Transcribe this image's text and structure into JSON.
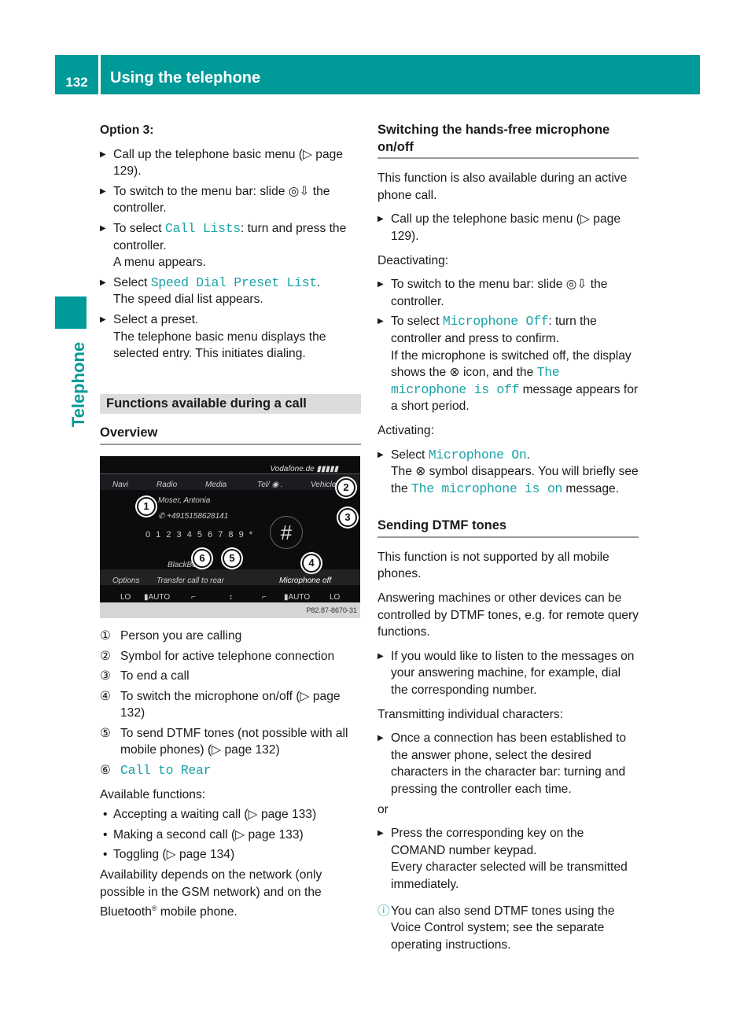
{
  "header": {
    "page_number": "132",
    "title": "Using the telephone"
  },
  "side_tab": "Telephone",
  "left": {
    "option_heading": "Option 3:",
    "steps": [
      {
        "a": "Call up the telephone basic menu (▷ page 129)."
      },
      {
        "a": "To switch to the menu bar: slide ◎⇩ the controller."
      },
      {
        "a": "To select ",
        "link": "Call Lists",
        "b": ": turn and press the controller.",
        "result": "A menu appears."
      },
      {
        "a": "Select ",
        "link": "Speed Dial Preset List",
        "b": ".",
        "result": "The speed dial list appears."
      },
      {
        "a": "Select a preset.",
        "result": "The telephone basic menu displays the selected entry. This initiates dialing."
      }
    ],
    "section_band": "Functions available during a call",
    "overview_heading": "Overview",
    "figure": {
      "carrier": "Vodafone.de ▮▮▮▮▮",
      "menu": [
        "Navi",
        "Radio",
        "Media",
        "Tel/ ◉ .",
        "Vehicle"
      ],
      "contact_name": "Moser, Antonia",
      "contact_number": "✆ +4915158628141",
      "digits": "0 1 2 3 4 5 6 7 8 9 *",
      "hash": "#",
      "device": "BlackBerry",
      "bottom_menu": [
        "Options",
        "Transfer call to rear",
        "Microphone off"
      ],
      "climate": [
        "LO",
        "▮AUTO",
        "⌐",
        "↕",
        "⌐",
        "▮AUTO",
        "LO"
      ],
      "code": "P82.87-8670-31",
      "callouts": [
        "1",
        "2",
        "3",
        "4",
        "5",
        "6"
      ]
    },
    "legend": [
      {
        "n": "①",
        "text": "Person you are calling"
      },
      {
        "n": "②",
        "text": "Symbol for active telephone connection"
      },
      {
        "n": "③",
        "text": "To end a call"
      },
      {
        "n": "④",
        "text": "To switch the microphone on/off (▷ page 132)"
      },
      {
        "n": "⑤",
        "text": "To send DTMF tones (not possible with all mobile phones) (▷ page 132)"
      },
      {
        "n": "⑥",
        "link": "Call to Rear"
      }
    ],
    "available_heading": "Available functions:",
    "available": [
      "Accepting a waiting call (▷ page 133)",
      "Making a second call (▷ page 133)",
      "Toggling (▷ page 134)"
    ],
    "availability_a": "Availability depends on the network (only possible in the GSM network) and on the Bluetooth",
    "availability_reg": "®",
    "availability_b": " mobile phone."
  },
  "right": {
    "mic_heading": "Switching the hands-free microphone on/off",
    "mic_intro": "This function is also available during an active phone call.",
    "mic_step1": "Call up the telephone basic menu (▷ page 129).",
    "deactivating": "Deactivating:",
    "deact_step1": "To switch to the menu bar: slide ◎⇩ the controller.",
    "deact_step2_a": "To select ",
    "deact_step2_link": "Microphone Off",
    "deact_step2_b": ": turn the controller and press to confirm.",
    "deact_result_a": "If the microphone is switched off, the display shows the ",
    "mic_off_icon": "⊗",
    "deact_result_b": " icon, and the ",
    "deact_result_link": "The microphone is off",
    "deact_result_c": " message appears for a short period.",
    "activating": "Activating:",
    "act_step_a": "Select ",
    "act_step_link": "Microphone On",
    "act_step_b": ".",
    "act_result_a": "The ",
    "act_result_b": " symbol disappears. You will briefly see the ",
    "act_result_link": "The microphone is on",
    "act_result_c": " message.",
    "dtmf_heading": "Sending DTMF tones",
    "dtmf_p1": "This function is not supported by all mobile phones.",
    "dtmf_p2": "Answering machines or other devices can be controlled by DTMF tones, e.g. for remote query functions.",
    "dtmf_step1": "If you would like to listen to the messages on your answering machine, for example, dial the corresponding number.",
    "transmitting": "Transmitting individual characters:",
    "trans_step1": "Once a connection has been established to the answer phone, select the desired characters in the character bar: turning and pressing the controller each time.",
    "or": "or",
    "trans_step2": "Press the corresponding key on the COMAND number keypad.",
    "trans_step2_result": "Every character selected will be transmitted immediately.",
    "info_icon": "info-icon",
    "info_text": "You can also send DTMF tones using the Voice Control system; see the separate operating instructions."
  },
  "colors": {
    "accent": "#009a98",
    "link": "#1aa3a8",
    "band": "#dcdcdc"
  }
}
